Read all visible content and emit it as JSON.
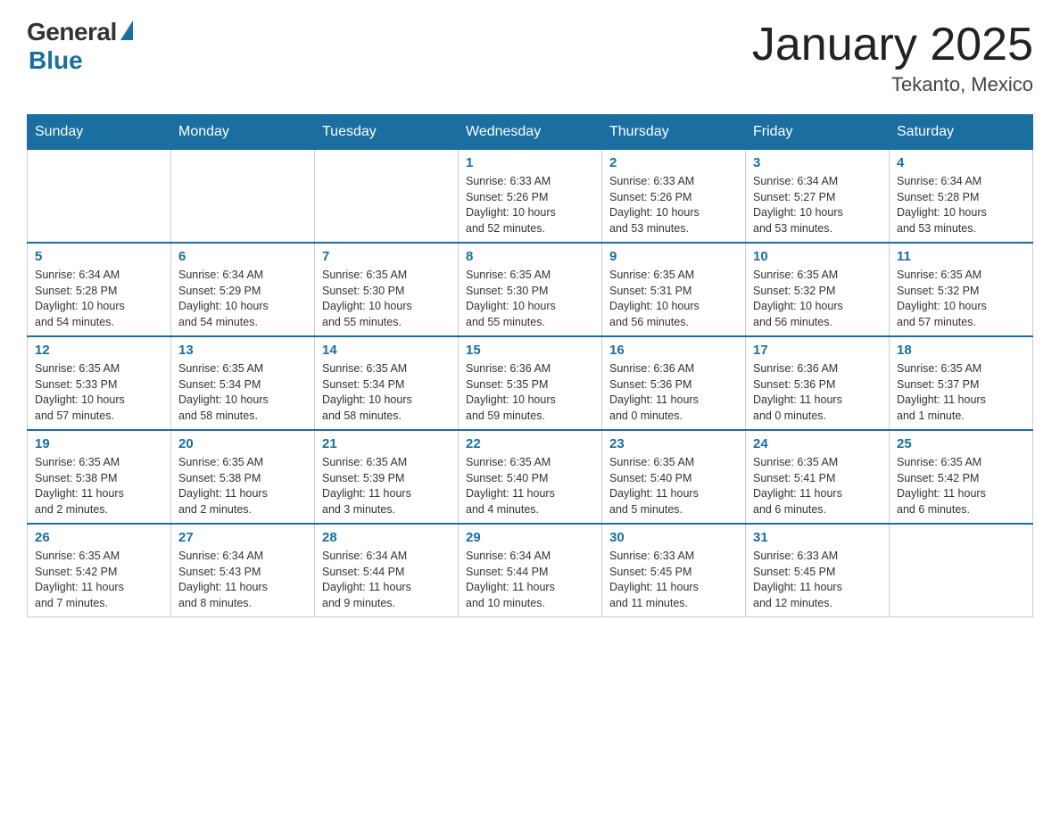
{
  "logo": {
    "general": "General",
    "blue": "Blue"
  },
  "title": "January 2025",
  "subtitle": "Tekanto, Mexico",
  "days_of_week": [
    "Sunday",
    "Monday",
    "Tuesday",
    "Wednesday",
    "Thursday",
    "Friday",
    "Saturday"
  ],
  "weeks": [
    [
      {
        "day": "",
        "info": ""
      },
      {
        "day": "",
        "info": ""
      },
      {
        "day": "",
        "info": ""
      },
      {
        "day": "1",
        "info": "Sunrise: 6:33 AM\nSunset: 5:26 PM\nDaylight: 10 hours\nand 52 minutes."
      },
      {
        "day": "2",
        "info": "Sunrise: 6:33 AM\nSunset: 5:26 PM\nDaylight: 10 hours\nand 53 minutes."
      },
      {
        "day": "3",
        "info": "Sunrise: 6:34 AM\nSunset: 5:27 PM\nDaylight: 10 hours\nand 53 minutes."
      },
      {
        "day": "4",
        "info": "Sunrise: 6:34 AM\nSunset: 5:28 PM\nDaylight: 10 hours\nand 53 minutes."
      }
    ],
    [
      {
        "day": "5",
        "info": "Sunrise: 6:34 AM\nSunset: 5:28 PM\nDaylight: 10 hours\nand 54 minutes."
      },
      {
        "day": "6",
        "info": "Sunrise: 6:34 AM\nSunset: 5:29 PM\nDaylight: 10 hours\nand 54 minutes."
      },
      {
        "day": "7",
        "info": "Sunrise: 6:35 AM\nSunset: 5:30 PM\nDaylight: 10 hours\nand 55 minutes."
      },
      {
        "day": "8",
        "info": "Sunrise: 6:35 AM\nSunset: 5:30 PM\nDaylight: 10 hours\nand 55 minutes."
      },
      {
        "day": "9",
        "info": "Sunrise: 6:35 AM\nSunset: 5:31 PM\nDaylight: 10 hours\nand 56 minutes."
      },
      {
        "day": "10",
        "info": "Sunrise: 6:35 AM\nSunset: 5:32 PM\nDaylight: 10 hours\nand 56 minutes."
      },
      {
        "day": "11",
        "info": "Sunrise: 6:35 AM\nSunset: 5:32 PM\nDaylight: 10 hours\nand 57 minutes."
      }
    ],
    [
      {
        "day": "12",
        "info": "Sunrise: 6:35 AM\nSunset: 5:33 PM\nDaylight: 10 hours\nand 57 minutes."
      },
      {
        "day": "13",
        "info": "Sunrise: 6:35 AM\nSunset: 5:34 PM\nDaylight: 10 hours\nand 58 minutes."
      },
      {
        "day": "14",
        "info": "Sunrise: 6:35 AM\nSunset: 5:34 PM\nDaylight: 10 hours\nand 58 minutes."
      },
      {
        "day": "15",
        "info": "Sunrise: 6:36 AM\nSunset: 5:35 PM\nDaylight: 10 hours\nand 59 minutes."
      },
      {
        "day": "16",
        "info": "Sunrise: 6:36 AM\nSunset: 5:36 PM\nDaylight: 11 hours\nand 0 minutes."
      },
      {
        "day": "17",
        "info": "Sunrise: 6:36 AM\nSunset: 5:36 PM\nDaylight: 11 hours\nand 0 minutes."
      },
      {
        "day": "18",
        "info": "Sunrise: 6:35 AM\nSunset: 5:37 PM\nDaylight: 11 hours\nand 1 minute."
      }
    ],
    [
      {
        "day": "19",
        "info": "Sunrise: 6:35 AM\nSunset: 5:38 PM\nDaylight: 11 hours\nand 2 minutes."
      },
      {
        "day": "20",
        "info": "Sunrise: 6:35 AM\nSunset: 5:38 PM\nDaylight: 11 hours\nand 2 minutes."
      },
      {
        "day": "21",
        "info": "Sunrise: 6:35 AM\nSunset: 5:39 PM\nDaylight: 11 hours\nand 3 minutes."
      },
      {
        "day": "22",
        "info": "Sunrise: 6:35 AM\nSunset: 5:40 PM\nDaylight: 11 hours\nand 4 minutes."
      },
      {
        "day": "23",
        "info": "Sunrise: 6:35 AM\nSunset: 5:40 PM\nDaylight: 11 hours\nand 5 minutes."
      },
      {
        "day": "24",
        "info": "Sunrise: 6:35 AM\nSunset: 5:41 PM\nDaylight: 11 hours\nand 6 minutes."
      },
      {
        "day": "25",
        "info": "Sunrise: 6:35 AM\nSunset: 5:42 PM\nDaylight: 11 hours\nand 6 minutes."
      }
    ],
    [
      {
        "day": "26",
        "info": "Sunrise: 6:35 AM\nSunset: 5:42 PM\nDaylight: 11 hours\nand 7 minutes."
      },
      {
        "day": "27",
        "info": "Sunrise: 6:34 AM\nSunset: 5:43 PM\nDaylight: 11 hours\nand 8 minutes."
      },
      {
        "day": "28",
        "info": "Sunrise: 6:34 AM\nSunset: 5:44 PM\nDaylight: 11 hours\nand 9 minutes."
      },
      {
        "day": "29",
        "info": "Sunrise: 6:34 AM\nSunset: 5:44 PM\nDaylight: 11 hours\nand 10 minutes."
      },
      {
        "day": "30",
        "info": "Sunrise: 6:33 AM\nSunset: 5:45 PM\nDaylight: 11 hours\nand 11 minutes."
      },
      {
        "day": "31",
        "info": "Sunrise: 6:33 AM\nSunset: 5:45 PM\nDaylight: 11 hours\nand 12 minutes."
      },
      {
        "day": "",
        "info": ""
      }
    ]
  ]
}
